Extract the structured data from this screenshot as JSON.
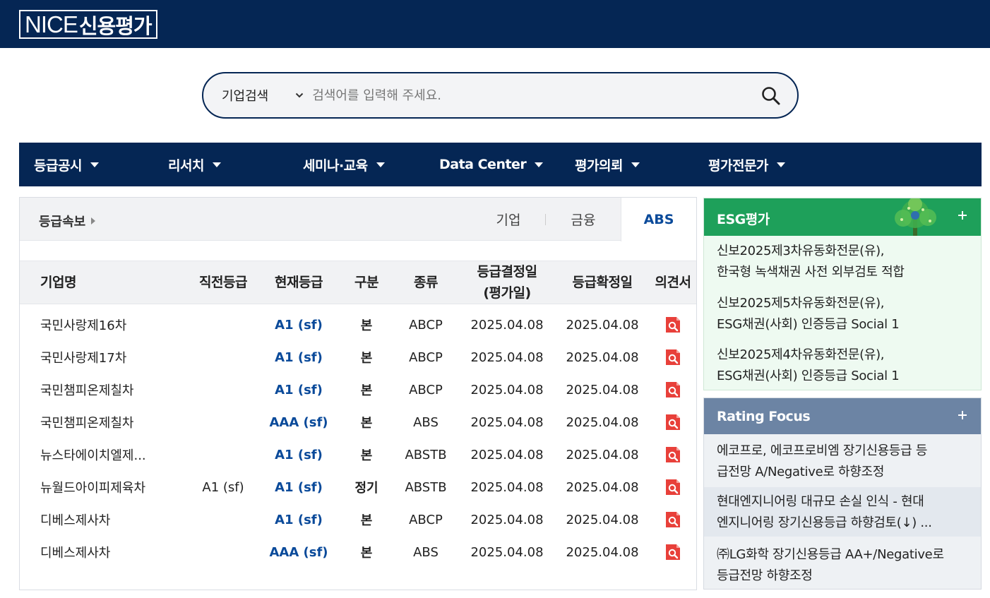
{
  "header": {
    "logo_text_en": "NICE",
    "logo_text_kr": "신용평가"
  },
  "search": {
    "category": "기업검색",
    "placeholder": "검색어를 입력해 주세요."
  },
  "nav": {
    "items": [
      {
        "label": "등급공시"
      },
      {
        "label": "리서치"
      },
      {
        "label": "세미나·교육"
      },
      {
        "label": "Data Center"
      },
      {
        "label": "평가의뢰"
      },
      {
        "label": "평가전문가"
      }
    ]
  },
  "ratings": {
    "title": "등급속보",
    "tabs": [
      {
        "label": "기업",
        "active": false
      },
      {
        "label": "금융",
        "active": false
      },
      {
        "label": "ABS",
        "active": true
      }
    ],
    "columns": {
      "name": "기업명",
      "prev_grade": "직전등급",
      "curr_grade": "현재등급",
      "kind": "구분",
      "type": "종류",
      "decision_date_1": "등급결정일",
      "decision_date_2": "(평가일)",
      "confirm_date": "등급확정일",
      "opinion": "의견서"
    },
    "rows": [
      {
        "name": "국민사랑제16차",
        "prev": "",
        "curr": "A1 (sf)",
        "kind": "본",
        "type": "ABCP",
        "decided": "2025.04.08",
        "confirmed": "2025.04.08"
      },
      {
        "name": "국민사랑제17차",
        "prev": "",
        "curr": "A1 (sf)",
        "kind": "본",
        "type": "ABCP",
        "decided": "2025.04.08",
        "confirmed": "2025.04.08"
      },
      {
        "name": "국민챔피온제칠차",
        "prev": "",
        "curr": "A1 (sf)",
        "kind": "본",
        "type": "ABCP",
        "decided": "2025.04.08",
        "confirmed": "2025.04.08"
      },
      {
        "name": "국민챔피온제칠차",
        "prev": "",
        "curr": "AAA (sf)",
        "kind": "본",
        "type": "ABS",
        "decided": "2025.04.08",
        "confirmed": "2025.04.08"
      },
      {
        "name": "뉴스타에이치엘제...",
        "prev": "",
        "curr": "A1 (sf)",
        "kind": "본",
        "type": "ABSTB",
        "decided": "2025.04.08",
        "confirmed": "2025.04.08"
      },
      {
        "name": "뉴월드아이피제육차",
        "prev": "A1 (sf)",
        "curr": "A1 (sf)",
        "kind": "정기",
        "type": "ABSTB",
        "decided": "2025.04.08",
        "confirmed": "2025.04.08"
      },
      {
        "name": "디베스제사차",
        "prev": "",
        "curr": "A1 (sf)",
        "kind": "본",
        "type": "ABCP",
        "decided": "2025.04.08",
        "confirmed": "2025.04.08"
      },
      {
        "name": "디베스제사차",
        "prev": "",
        "curr": "AAA (sf)",
        "kind": "본",
        "type": "ABS",
        "decided": "2025.04.08",
        "confirmed": "2025.04.08"
      }
    ]
  },
  "esg": {
    "title": "ESG평가",
    "items": [
      {
        "line1": "신보2025제3차유동화전문(유),",
        "line2": "한국형 녹색채권 사전 외부검토 적합"
      },
      {
        "line1": "신보2025제5차유동화전문(유),",
        "line2": "ESG채권(사회) 인증등급 Social 1"
      },
      {
        "line1": "신보2025제4차유동화전문(유),",
        "line2": "ESG채권(사회) 인증등급 Social 1"
      }
    ]
  },
  "rating_focus": {
    "title": "Rating Focus",
    "items": [
      {
        "line1": "에코프로, 에코프로비엠 장기신용등급 등",
        "line2": "급전망 A/Negative로 하향조정"
      },
      {
        "line1": "현대엔지니어링 대규모 손실 인식 - 현대",
        "line2": "엔지니어링 장기신용등급 하향검토(↓) ..."
      },
      {
        "line1": "㈜LG화학 장기신용등급 AA+/Negative로",
        "line2": "등급전망 하향조정"
      }
    ]
  },
  "colors": {
    "navy": "#052654",
    "grade_blue": "#0a4a9a",
    "esg_green": "#1ea05a",
    "focus_slate": "#6c84a4",
    "pdf_red": "#e8403a"
  }
}
